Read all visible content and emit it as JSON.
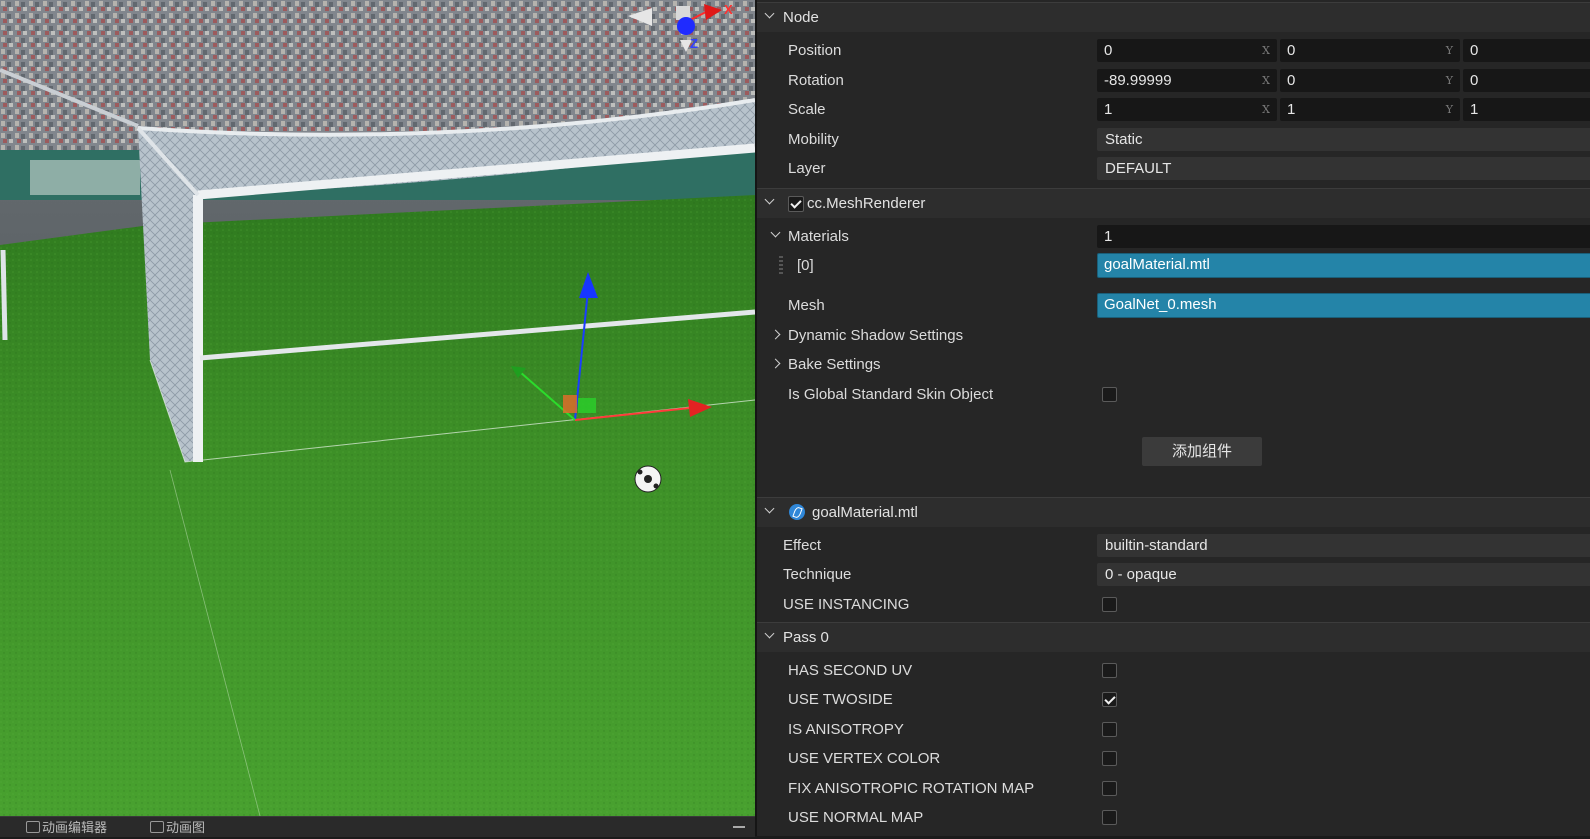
{
  "scene": {
    "gizmo_axes": {
      "x": "X",
      "z": "Z"
    },
    "bottom_tabs": [
      "动画编辑器",
      "动画图"
    ]
  },
  "inspector": {
    "node": {
      "title": "Node",
      "position": {
        "label": "Position",
        "x": "0",
        "y": "0",
        "z": "0"
      },
      "rotation": {
        "label": "Rotation",
        "x": "-89.99999",
        "y": "0",
        "z": "0"
      },
      "scale": {
        "label": "Scale",
        "x": "1",
        "y": "1",
        "z": "1"
      },
      "axis_x": "X",
      "axis_y": "Y",
      "mobility": {
        "label": "Mobility",
        "value": "Static"
      },
      "layer": {
        "label": "Layer",
        "value": "DEFAULT"
      }
    },
    "mesh_renderer": {
      "title": "cc.MeshRenderer",
      "enabled": true,
      "materials": {
        "label": "Materials",
        "count": "1"
      },
      "material_0": {
        "label": "[0]",
        "value": "goalMaterial.mtl"
      },
      "mesh": {
        "label": "Mesh",
        "value": "GoalNet_0.mesh"
      },
      "dynamic_shadow": "Dynamic Shadow Settings",
      "bake_settings": "Bake Settings",
      "global_skin": {
        "label": "Is Global Standard Skin Object",
        "checked": false
      }
    },
    "add_component": "添加组件",
    "material": {
      "title": "goalMaterial.mtl",
      "effect": {
        "label": "Effect",
        "value": "builtin-standard"
      },
      "technique": {
        "label": "Technique",
        "value": "0 - opaque"
      },
      "use_instancing": {
        "label": "USE INSTANCING",
        "checked": false
      }
    },
    "pass0": {
      "title": "Pass 0",
      "has_second_uv": {
        "label": "HAS SECOND UV",
        "checked": false
      },
      "use_twoside": {
        "label": "USE TWOSIDE",
        "checked": true
      },
      "is_anisotropy": {
        "label": "IS ANISOTROPY",
        "checked": false
      },
      "use_vertex_color": {
        "label": "USE VERTEX COLOR",
        "checked": false
      },
      "fix_aniso": {
        "label": "FIX ANISOTROPIC ROTATION MAP",
        "checked": false
      },
      "use_normal_map": {
        "label": "USE NORMAL MAP",
        "checked": false
      }
    }
  },
  "colors": {
    "asset_field": "#2484a8",
    "panel_bg": "#262626",
    "grass": "#3e8e2a"
  }
}
